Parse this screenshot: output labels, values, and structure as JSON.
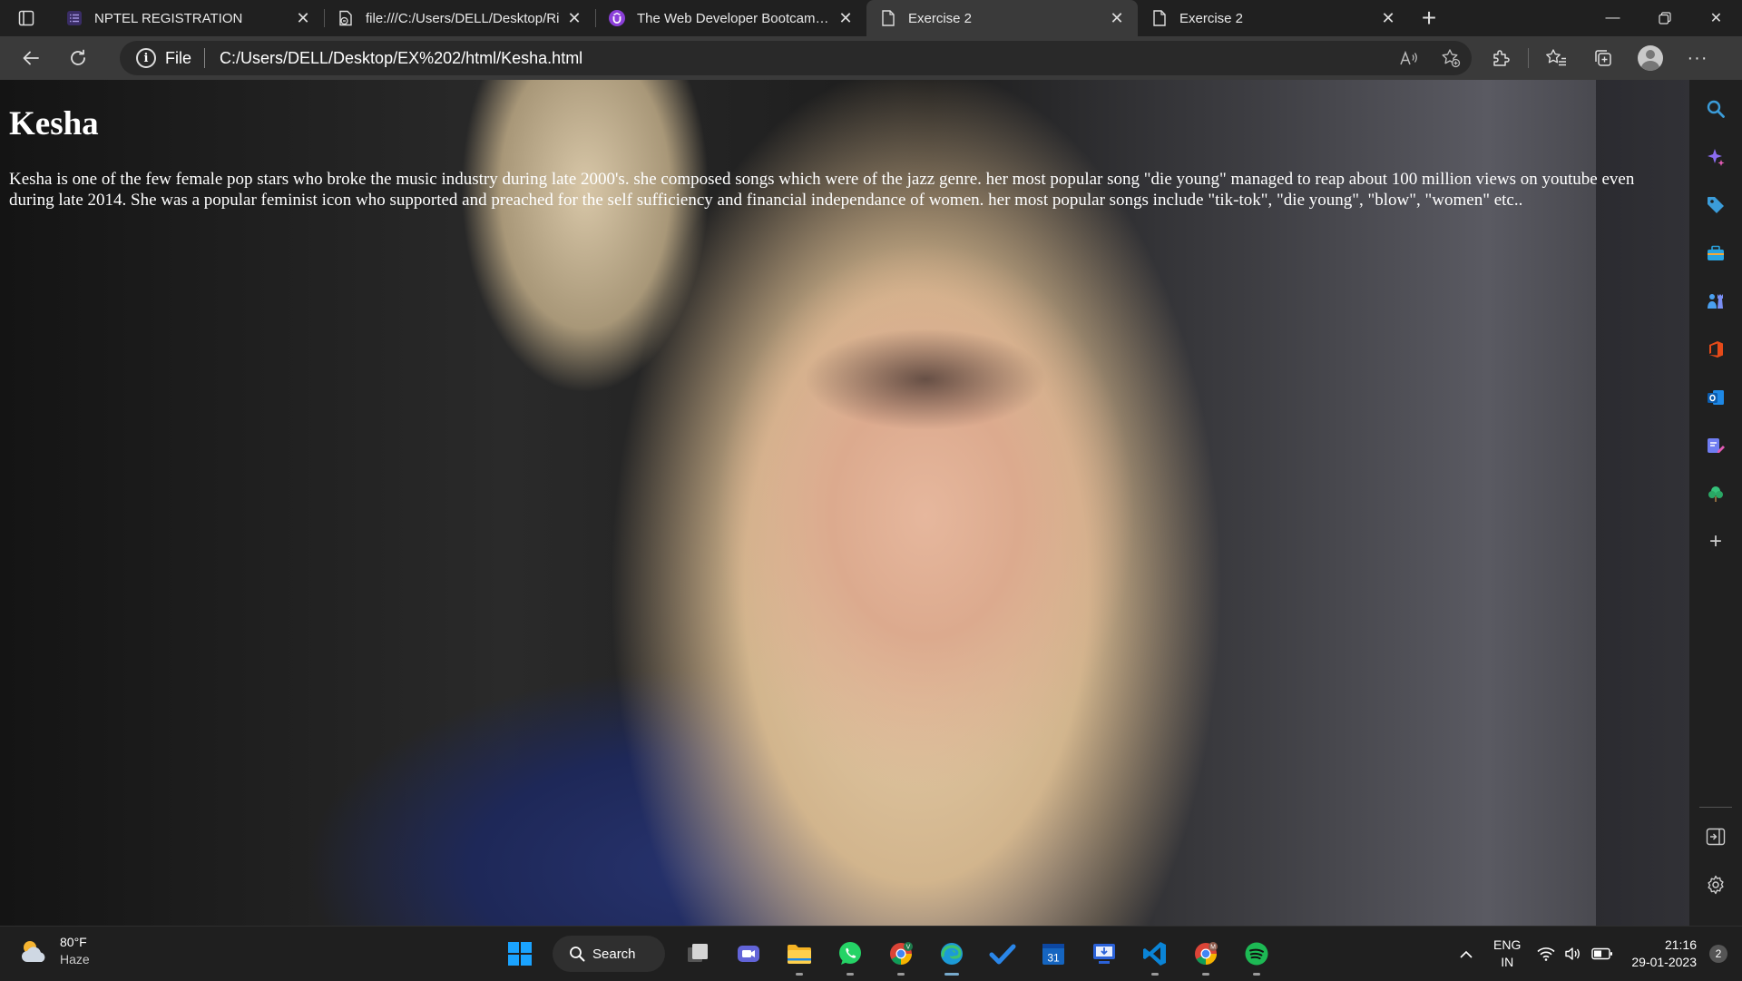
{
  "browser": {
    "tabs": [
      {
        "title": "NPTEL REGISTRATION",
        "icon": "list-icon",
        "active": false
      },
      {
        "title": "file:///C:/Users/DELL/Desktop/Ri",
        "icon": "file-link-icon",
        "active": false
      },
      {
        "title": "The Web Developer Bootcamp: L",
        "icon": "udemy-icon",
        "active": false
      },
      {
        "title": "Exercise 2",
        "icon": "page-icon",
        "active": true
      },
      {
        "title": "Exercise 2",
        "icon": "page-icon",
        "active": false
      }
    ],
    "omnibox": {
      "scheme_label": "File",
      "url": "C:/Users/DELL/Desktop/EX%202/html/Kesha.html"
    }
  },
  "page": {
    "heading": "Kesha",
    "paragraph": "Kesha is one of the few female pop stars who broke the music industry during late 2000's. she composed songs which were of the jazz genre. her most popular song \"die young\" managed to reap about 100 million views on youtube even during late 2014. She was a popular feminist icon who supported and preached for the self sufficiency and financial independance of women. her most popular songs include \"tik-tok\", \"die young\", \"blow\", \"women\" etc.."
  },
  "taskbar": {
    "weather": {
      "temp": "80°F",
      "condition": "Haze"
    },
    "search_label": "Search",
    "language": {
      "line1": "ENG",
      "line2": "IN"
    },
    "clock": {
      "time": "21:16",
      "date": "29-01-2023"
    },
    "notification_count": "2"
  },
  "colors": {
    "accent_edge": "#3b9cd9",
    "windows_blue": "#1aa3ff",
    "whatsapp": "#25d366",
    "spotify": "#1db954",
    "vscode": "#0a84d6"
  }
}
